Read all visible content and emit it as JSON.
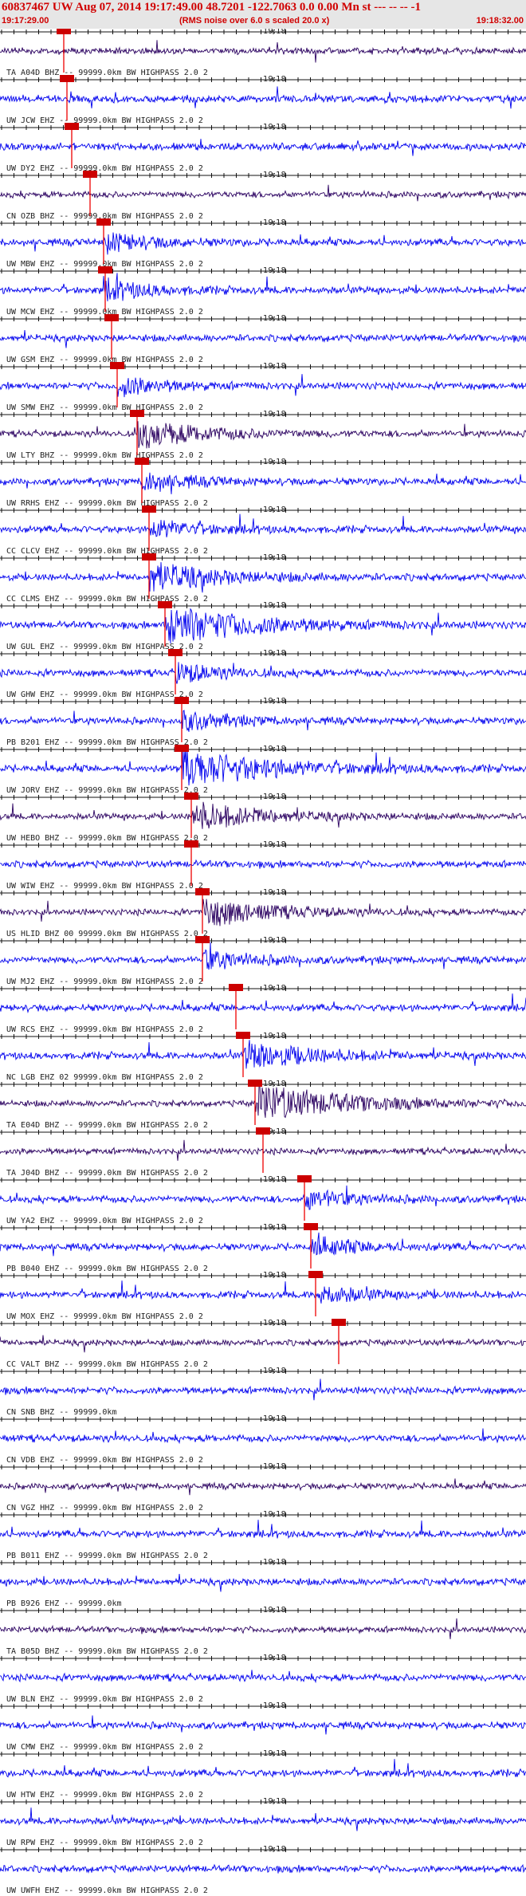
{
  "header": {
    "title": "60837467 UW Aug 07, 2014 19:17:49.00   48.7201 -122.7063  0.0 0.00 Mn st --- -- --  -1",
    "start_time": "19:17:29.00",
    "end_time": "19:18:32.00",
    "note": "(RMS noise over 6.0 s scaled 20.0 x)"
  },
  "minute_label": "19:18",
  "colors": {
    "trace_blue": "#0000ee",
    "trace_purple": "#2a0060",
    "pick": "#ee0000",
    "pick_bg": "#cc0000"
  },
  "traces": [
    {
      "label": "TA A04D BHZ -- 99999.0km BW  HIGHPASS  2.0  2",
      "pick": 80,
      "color": "purple",
      "event": 0
    },
    {
      "label": "UW JCW EHZ -- 99999.0km BW  HIGHPASS  2.0  2",
      "pick": 84,
      "color": "blue",
      "event": 0
    },
    {
      "label": "UW DY2 EHZ -- 99999.0km BW  HIGHPASS  2.0  2",
      "pick": 90,
      "color": "blue",
      "event": 0
    },
    {
      "label": "CN OZB BHZ -- 99999.0km BW  HIGHPASS  2.0  2",
      "pick": 113,
      "color": "purple",
      "event": 0
    },
    {
      "label": "UW MBW EHZ -- 99999.0km BW  HIGHPASS  2.0  2",
      "pick": 130,
      "color": "blue",
      "event": 1
    },
    {
      "label": "UW MCW EHZ -- 99999.0km BW  HIGHPASS  2.0  2",
      "pick": 132,
      "color": "blue",
      "event": 1
    },
    {
      "label": "UW GSM EHZ -- 99999.0km BW  HIGHPASS  2.0  2",
      "pick": 140,
      "color": "blue",
      "event": 0
    },
    {
      "label": "UW SMW EHZ -- 99999.0km BW  HIGHPASS  2.0  2",
      "pick": 147,
      "color": "blue",
      "event": 1
    },
    {
      "label": "UW LTY BHZ -- 99999.0km BW  HIGHPASS  2.0  2",
      "pick": 172,
      "color": "purple",
      "event": 2
    },
    {
      "label": "UW RRHS EHZ -- 99999.0km BW  HIGHPASS  2.0  2",
      "pick": 178,
      "color": "blue",
      "event": 1
    },
    {
      "label": "CC CLCV EHZ -- 99999.0km BW  HIGHPASS  2.0  2",
      "pick": 187,
      "color": "blue",
      "event": 1
    },
    {
      "label": "CC CLMS EHZ -- 99999.0km BW  HIGHPASS  2.0  2",
      "pick": 187,
      "color": "blue",
      "event": 2
    },
    {
      "label": "UW GUL EHZ -- 99999.0km BW  HIGHPASS  2.0  2",
      "pick": 207,
      "color": "blue",
      "event": 3
    },
    {
      "label": "UW GHW EHZ -- 99999.0km BW  HIGHPASS  2.0  2",
      "pick": 220,
      "color": "blue",
      "event": 1
    },
    {
      "label": "PB B201 EHZ -- 99999.0km BW  HIGHPASS  2.0  2",
      "pick": 228,
      "color": "blue",
      "event": 1
    },
    {
      "label": "UW JORV EHZ -- 99999.0km BW  HIGHPASS  2.0  2",
      "pick": 228,
      "color": "blue",
      "event": 3
    },
    {
      "label": "UW HEBO BHZ -- 99999.0km BW  HIGHPASS  2.0  2",
      "pick": 240,
      "color": "purple",
      "event": 2
    },
    {
      "label": "UW WIW EHZ -- 99999.0km BW  HIGHPASS  2.0  2",
      "pick": 240,
      "color": "blue",
      "event": 0
    },
    {
      "label": "US HLID BHZ 00 99999.0km BW  HIGHPASS  2.0  2",
      "pick": 254,
      "color": "purple",
      "event": 2
    },
    {
      "label": "UW MJ2 EHZ -- 99999.0km BW  HIGHPASS  2.0  2",
      "pick": 254,
      "color": "blue",
      "event": 1
    },
    {
      "label": "UW RCS EHZ -- 99999.0km BW  HIGHPASS  2.0  2",
      "pick": 296,
      "color": "blue",
      "event": 0
    },
    {
      "label": "NC LGB EHZ 02 99999.0km BW  HIGHPASS  2.0  2",
      "pick": 305,
      "color": "blue",
      "event": 2
    },
    {
      "label": "TA E04D BHZ -- 99999.0km BW  HIGHPASS  2.0  2",
      "pick": 320,
      "color": "purple",
      "event": 3
    },
    {
      "label": "TA J04D BHZ -- 99999.0km BW  HIGHPASS  2.0  2",
      "pick": 330,
      "color": "purple",
      "event": 0
    },
    {
      "label": "UW YA2 EHZ -- 99999.0km BW  HIGHPASS  2.0  2",
      "pick": 382,
      "color": "blue",
      "event": 1
    },
    {
      "label": "PB B040 EHZ -- 99999.0km BW  HIGHPASS  2.0  2",
      "pick": 390,
      "color": "blue",
      "event": 1
    },
    {
      "label": "UW MOX EHZ -- 99999.0km BW  HIGHPASS  2.0  2",
      "pick": 396,
      "color": "blue",
      "event": 1
    },
    {
      "label": "CC VALT BHZ -- 99999.0km BW  HIGHPASS  2.0  2",
      "pick": 425,
      "color": "purple",
      "event": 0
    },
    {
      "label": "CN SNB BHZ -- 99999.0km",
      "pick": null,
      "color": "blue",
      "event": 0
    },
    {
      "label": "CN VDB EHZ -- 99999.0km BW  HIGHPASS  2.0  2",
      "pick": null,
      "color": "blue",
      "event": 0
    },
    {
      "label": "CN VGZ HHZ -- 99999.0km BW  HIGHPASS  2.0  2",
      "pick": null,
      "color": "purple",
      "event": 0
    },
    {
      "label": "PB B011 EHZ -- 99999.0km BW  HIGHPASS  2.0  2",
      "pick": null,
      "color": "blue",
      "event": 0
    },
    {
      "label": "PB B926 EHZ -- 99999.0km",
      "pick": null,
      "color": "blue",
      "event": 0
    },
    {
      "label": "TA B05D BHZ -- 99999.0km BW  HIGHPASS  2.0  2",
      "pick": null,
      "color": "purple",
      "event": 0
    },
    {
      "label": "UW BLN EHZ -- 99999.0km BW  HIGHPASS  2.0  2",
      "pick": null,
      "color": "blue",
      "event": 0
    },
    {
      "label": "UW CMW EHZ -- 99999.0km BW  HIGHPASS  2.0  2",
      "pick": null,
      "color": "blue",
      "event": 0
    },
    {
      "label": "UW HTW EHZ -- 99999.0km BW  HIGHPASS  2.0  2",
      "pick": null,
      "color": "blue",
      "event": 0
    },
    {
      "label": "UW RPW EHZ -- 99999.0km BW  HIGHPASS  2.0  2",
      "pick": null,
      "color": "blue",
      "event": 1
    },
    {
      "label": "UW UWFH EHZ -- 99999.0km BW  HIGHPASS  2.0  2",
      "pick": null,
      "color": "blue",
      "event": 0
    }
  ]
}
